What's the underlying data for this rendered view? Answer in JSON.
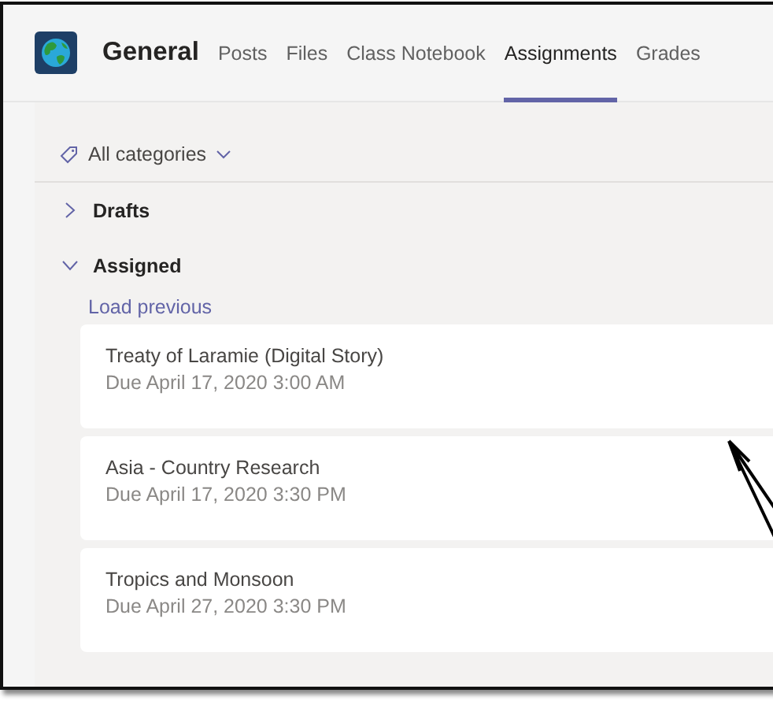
{
  "team": {
    "name": "General"
  },
  "tabs": [
    {
      "label": "Posts",
      "selected": false
    },
    {
      "label": "Files",
      "selected": false
    },
    {
      "label": "Class Notebook",
      "selected": false
    },
    {
      "label": "Assignments",
      "selected": true
    },
    {
      "label": "Grades",
      "selected": false
    }
  ],
  "filter": {
    "label": "All categories"
  },
  "sections": [
    {
      "title": "Drafts",
      "expanded": false
    },
    {
      "title": "Assigned",
      "expanded": true,
      "load_previous": "Load previous",
      "assignments": [
        {
          "title": "Treaty of Laramie (Digital Story)",
          "due": "Due April 17, 2020 3:00 AM"
        },
        {
          "title": "Asia - Country Research",
          "due": "Due April 17, 2020 3:30 PM"
        },
        {
          "title": "Tropics and Monsoon",
          "due": "Due April 27, 2020 3:30 PM"
        }
      ]
    }
  ]
}
